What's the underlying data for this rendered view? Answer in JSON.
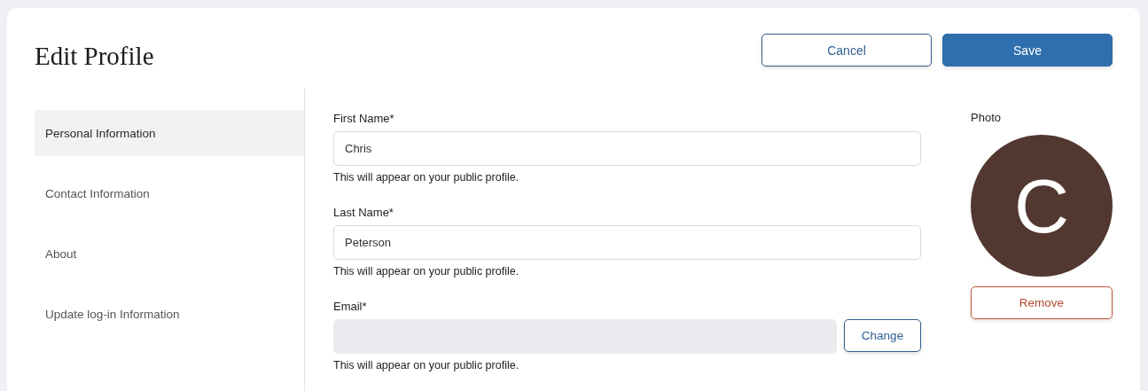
{
  "title": "Edit Profile",
  "actions": [
    {
      "label": "Cancel",
      "kind": "secondary"
    },
    {
      "label": "Save",
      "kind": "primary"
    }
  ],
  "sidebar": {
    "items": [
      {
        "label": "Personal Information",
        "selected": true
      },
      {
        "label": "Contact Information",
        "selected": false
      },
      {
        "label": "About",
        "selected": false
      },
      {
        "label": "Update log-in Information",
        "selected": false
      }
    ]
  },
  "fields": [
    {
      "label": "First Name*",
      "value": "Chris",
      "disabled": false,
      "help": "This will appear on your public profile."
    },
    {
      "label": "Last Name*",
      "value": "Peterson",
      "disabled": false,
      "help": "This will appear on your public profile."
    },
    {
      "label": "Email*",
      "disabled": true,
      "button": "Change",
      "help": "This will appear on your public profile."
    }
  ],
  "photo": {
    "label": "Photo",
    "initial": "C",
    "remove": "Remove"
  }
}
